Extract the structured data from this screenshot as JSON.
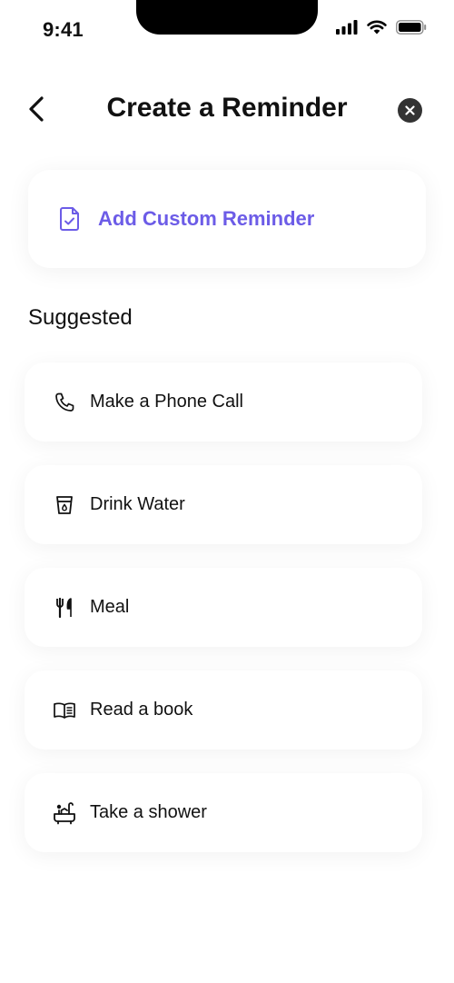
{
  "status_bar": {
    "time": "9:41"
  },
  "header": {
    "title": "Create a Reminder"
  },
  "custom": {
    "label": "Add Custom Reminder",
    "accent": "#6C5CE7"
  },
  "suggested": {
    "title": "Suggested",
    "items": [
      {
        "label": "Make a Phone Call",
        "icon": "phone-icon"
      },
      {
        "label": "Drink Water",
        "icon": "glass-icon"
      },
      {
        "label": "Meal",
        "icon": "cutlery-icon"
      },
      {
        "label": "Read a book",
        "icon": "book-icon"
      },
      {
        "label": "Take a shower",
        "icon": "bathtub-icon"
      }
    ]
  }
}
